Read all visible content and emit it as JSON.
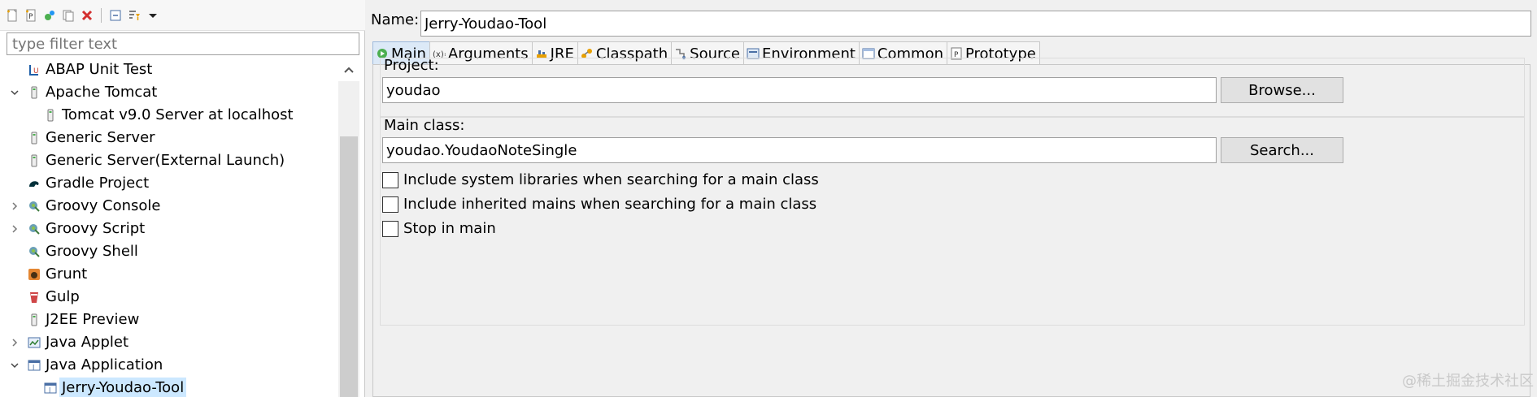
{
  "filter": {
    "placeholder": "type filter text"
  },
  "tree": [
    {
      "label": "ABAP Unit Test",
      "icon": "abap-unit-icon",
      "level": 1,
      "twisty": ""
    },
    {
      "label": "Apache Tomcat",
      "icon": "tomcat-icon",
      "level": 1,
      "twisty": "expanded"
    },
    {
      "label": "Tomcat v9.0 Server at localhost",
      "icon": "server-icon",
      "level": 2,
      "twisty": ""
    },
    {
      "label": "Generic Server",
      "icon": "server-icon",
      "level": 1,
      "twisty": ""
    },
    {
      "label": "Generic Server(External Launch)",
      "icon": "server-icon",
      "level": 1,
      "twisty": ""
    },
    {
      "label": "Gradle Project",
      "icon": "gradle-icon",
      "level": 1,
      "twisty": ""
    },
    {
      "label": "Groovy Console",
      "icon": "groovy-icon",
      "level": 1,
      "twisty": "collapsed"
    },
    {
      "label": "Groovy Script",
      "icon": "groovy-icon",
      "level": 1,
      "twisty": "collapsed"
    },
    {
      "label": "Groovy Shell",
      "icon": "groovy-icon",
      "level": 1,
      "twisty": ""
    },
    {
      "label": "Grunt",
      "icon": "grunt-icon",
      "level": 1,
      "twisty": ""
    },
    {
      "label": "Gulp",
      "icon": "gulp-icon",
      "level": 1,
      "twisty": ""
    },
    {
      "label": "J2EE Preview",
      "icon": "server-icon",
      "level": 1,
      "twisty": ""
    },
    {
      "label": "Java Applet",
      "icon": "applet-icon",
      "level": 1,
      "twisty": "collapsed"
    },
    {
      "label": "Java Application",
      "icon": "java-app-icon",
      "level": 1,
      "twisty": "expanded"
    },
    {
      "label": "Jerry-Youdao-Tool",
      "icon": "java-app-icon",
      "level": 2,
      "twisty": "",
      "selected": true
    }
  ],
  "name": {
    "label": "Name:",
    "value": "Jerry-Youdao-Tool"
  },
  "tabs": [
    {
      "label": "Main",
      "icon": "main-tab-icon",
      "active": true
    },
    {
      "label": "Arguments",
      "icon": "arguments-tab-icon"
    },
    {
      "label": "JRE",
      "icon": "jre-tab-icon"
    },
    {
      "label": "Classpath",
      "icon": "classpath-tab-icon"
    },
    {
      "label": "Source",
      "icon": "source-tab-icon"
    },
    {
      "label": "Environment",
      "icon": "environment-tab-icon"
    },
    {
      "label": "Common",
      "icon": "common-tab-icon"
    },
    {
      "label": "Prototype",
      "icon": "prototype-tab-icon"
    }
  ],
  "project": {
    "label": "Project:",
    "value": "youdao",
    "button": "Browse..."
  },
  "main_class": {
    "label": "Main class:",
    "value": "youdao.YoudaoNoteSingle",
    "button": "Search..."
  },
  "options": [
    "Include system libraries when searching for a main class",
    "Include inherited mains when searching for a main class",
    "Stop in main"
  ],
  "watermark": "@稀土掘金技术社区",
  "colors": {
    "selection": "#cce8ff",
    "active_tab": "#dce9f7",
    "panel_bg": "#f0f0f0"
  }
}
